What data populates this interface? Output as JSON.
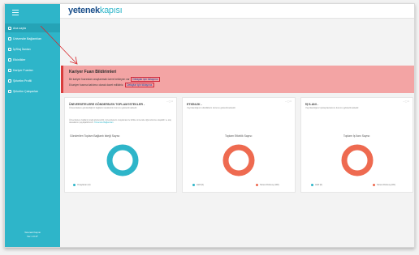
{
  "app": {
    "logo_a": "yetenek",
    "logo_b": "kapısı"
  },
  "sidebar": {
    "items": [
      {
        "label": "Ana sayfa",
        "active": true
      },
      {
        "label": "Üniversite Bağlantıları"
      },
      {
        "label": "İş/Staj İlanları"
      },
      {
        "label": "Etkinlikler"
      },
      {
        "label": "Kariyer Fuarları"
      },
      {
        "label": "Şirketim Profili"
      },
      {
        "label": "Şirketim Çalışanları"
      }
    ],
    "footer_line1": "Yetenek Kapısı",
    "footer_line2": "Ver 1.0.47"
  },
  "banner": {
    "title": "Kariyer Fuarı Bildirimleri",
    "line1_text": "Bir kariyer fuarından onaylanmak üzere bekleyen var",
    "line1_link": "Detaylar için tıklayınız.",
    "line2_text": "8 kariyer fuarına katılımcı olarak davet edildiniz.",
    "line2_link": "Detaylar için tıklayınız."
  },
  "cards": [
    {
      "title": "ÜNİVERSİTELERE GÖNDERİLEN TOPLAM İSTEKLER -",
      "subtitle": "Üniversitelere gönderdiğiniz bağlantı isteklerinin durumu gösterilmektedir.",
      "description": "Üniversitelere bağlantı isteği gönderebilir, üniversitelerin onaylaması ile birlikte üniversite öğrencilerine ulaşabilir ve staj olanaklarını paylaşabilirsiniz.",
      "description_link": "Üniversite Bağlantıları",
      "chart_title": "Gönderilen Toplam Bağlantı İsteği Sayısı:",
      "legend": [
        {
          "label": "Onaylanan (0)",
          "color": "#2eb5c9"
        }
      ],
      "controls": "– ▢ ×"
    },
    {
      "title": "ETKİNLİK -",
      "subtitle": "Yayınlandığınız etkinliklerin durumu gösterilmektedir.",
      "chart_title": "Toplam Etkinlik Sayısı:",
      "legend": [
        {
          "label": "Aktif (0)",
          "color": "#2eb5c9"
        },
        {
          "label": "Süresi Dolmuş (100)",
          "color": "#ee6a50"
        }
      ],
      "controls": "– ▢ ×"
    },
    {
      "title": "İŞ İLANI -",
      "subtitle": "Yayınlandığınız iş/staj ilanlarının durumu gösterilmektedir.",
      "chart_title": "Toplam İş İlanı Sayısı:",
      "legend": [
        {
          "label": "Aktif (0)",
          "color": "#2eb5c9"
        },
        {
          "label": "Süresi Dolmuş (0%)",
          "color": "#ee6a50"
        }
      ],
      "controls": "– ▢ ×"
    }
  ],
  "chart_data": [
    {
      "type": "pie",
      "title": "Gönderilen Toplam Bağlantı İsteği Sayısı:",
      "categories": [
        "Onaylanan"
      ],
      "values": [
        100
      ],
      "colors": [
        "#2eb5c9"
      ]
    },
    {
      "type": "pie",
      "title": "Toplam Etkinlik Sayısı:",
      "categories": [
        "Aktif",
        "Süresi Dolmuş"
      ],
      "values": [
        0,
        100
      ],
      "colors": [
        "#2eb5c9",
        "#ee6a50"
      ]
    },
    {
      "type": "pie",
      "title": "Toplam İş İlanı Sayısı:",
      "categories": [
        "Aktif",
        "Süresi Dolmuş"
      ],
      "values": [
        0,
        100
      ],
      "colors": [
        "#2eb5c9",
        "#ee6a50"
      ]
    }
  ]
}
